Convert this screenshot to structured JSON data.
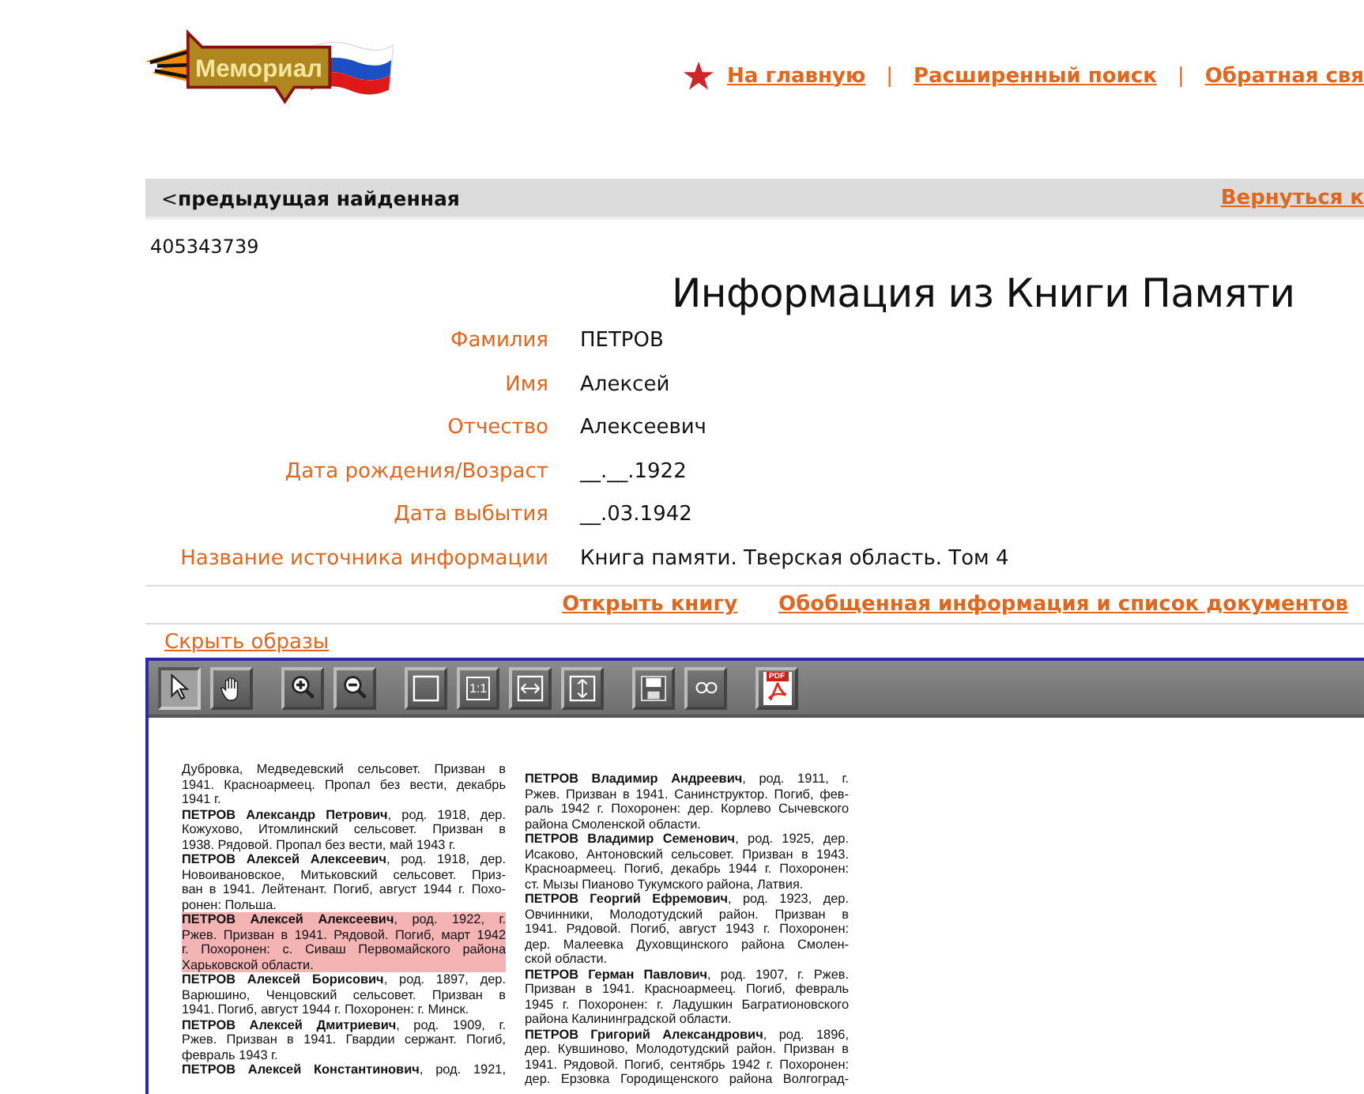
{
  "logo": {
    "text": "Мемориал"
  },
  "nav": {
    "separator": "|",
    "links": [
      {
        "label": "На главную"
      },
      {
        "label": "Расширенный поиск"
      },
      {
        "label": "Обратная свя"
      }
    ]
  },
  "result_bar": {
    "previous": "<**предыдущая найденная**",
    "back": "Вернуться к"
  },
  "record_id": "405343739",
  "title": "Информация из Книги Памяти",
  "fields": [
    {
      "label": "Фамилия",
      "value": "ПЕТРОВ"
    },
    {
      "label": "Имя",
      "value": "Алексей"
    },
    {
      "label": "Отчество",
      "value": "Алексеевич"
    },
    {
      "label": "Дата рождения/Возраст",
      "value": "__.__.1922"
    },
    {
      "label": "Дата выбытия",
      "value": "__.03.1942"
    },
    {
      "label": "Название источника информации",
      "value": "Книга памяти. Тверская область. Том 4"
    }
  ],
  "links": [
    "Открыть книгу",
    "Обобщенная информация и список документов"
  ],
  "hide_images": "Скрыть образы",
  "viewer": {
    "tools": [
      {
        "kind": "select",
        "selected": true
      },
      {
        "kind": "pan",
        "selected": false
      },
      {
        "kind": "zoom-in",
        "selected": false
      },
      {
        "kind": "zoom-out",
        "selected": false
      },
      {
        "kind": "fit-page",
        "selected": false
      },
      {
        "kind": "actual-size",
        "label": "1:1",
        "selected": false
      },
      {
        "kind": "fit-width",
        "selected": false
      },
      {
        "kind": "fit-height",
        "selected": false
      },
      {
        "kind": "save",
        "selected": false
      },
      {
        "kind": "link",
        "selected": false
      },
      {
        "kind": "pdf",
        "label": "PDF",
        "selected": false
      }
    ],
    "columns": [
      [
        {
          "text": "Дубровка, Медведевский сельсовет. Призван в",
          "justified": true,
          "highlighted": false
        },
        {
          "text": "1941. Красноармеец. Пропал без вести, декабрь",
          "justified": true,
          "highlighted": false
        },
        {
          "text": "1941 г.",
          "justified": false,
          "highlighted": false
        },
        {
          "text": "**ПЕТРОВ Александр Петрович**, род. 1918, дер.",
          "justified": true,
          "highlighted": false
        },
        {
          "text": "Кожухово, Итомлинский сельсовет. Призван в",
          "justified": true,
          "highlighted": false
        },
        {
          "text": "1938. Рядовой. Пропал без вести, май 1943 г.",
          "justified": false,
          "highlighted": false
        },
        {
          "text": "**ПЕТРОВ Алексей Алексеевич**, род. 1918, дер.",
          "justified": true,
          "highlighted": false
        },
        {
          "text": "Новоивановское, Митьковский сельсовет. Приз-",
          "justified": true,
          "highlighted": false
        },
        {
          "text": "ван в 1941. Лейтенант. Погиб, август 1944 г. Похо-",
          "justified": true,
          "highlighted": false
        },
        {
          "text": "ронен: Польша.",
          "justified": false,
          "highlighted": false
        },
        {
          "text": "**ПЕТРОВ Алексей Алексеевич**, род. 1922, г.",
          "justified": true,
          "highlighted": true
        },
        {
          "text": "Ржев. Призван в 1941. Рядовой. Погиб, март 1942",
          "justified": true,
          "highlighted": true
        },
        {
          "text": "г. Похоронен: с. Сиваш Первомайского района",
          "justified": true,
          "highlighted": true
        },
        {
          "text": "Харьковской области.",
          "justified": false,
          "highlighted": true
        },
        {
          "text": "**ПЕТРОВ Алексей Борисович**, род. 1897, дер.",
          "justified": true,
          "highlighted": false
        },
        {
          "text": "Варюшино, Ченцовский сельсовет. Призван в",
          "justified": true,
          "highlighted": false
        },
        {
          "text": "1941. Погиб, август 1944 г. Похоронен: г. Минск.",
          "justified": false,
          "highlighted": false
        },
        {
          "text": "**ПЕТРОВ Алексей Дмитриевич**, род. 1909, г.",
          "justified": true,
          "highlighted": false
        },
        {
          "text": "Ржев. Призван в 1941. Гвардии сержант. Погиб,",
          "justified": true,
          "highlighted": false
        },
        {
          "text": "февраль 1943 г.",
          "justified": false,
          "highlighted": false
        },
        {
          "text": "**ПЕТРОВ Алексей Константинович**, род. 1921,",
          "justified": true,
          "highlighted": false
        }
      ],
      [
        {
          "text": "**ПЕТРОВ Владимир Андреевич**, род. 1911, г.",
          "justified": true,
          "highlighted": false
        },
        {
          "text": "Ржев. Призван в 1941. Санинструктор. Погиб, фев-",
          "justified": true,
          "highlighted": false
        },
        {
          "text": "раль 1942 г. Похоронен: дер. Корлево Сычевского",
          "justified": true,
          "highlighted": false
        },
        {
          "text": "района Смоленской области.",
          "justified": false,
          "highlighted": false
        },
        {
          "text": "**ПЕТРОВ Владимир Семенович**, род. 1925, дер.",
          "justified": true,
          "highlighted": false
        },
        {
          "text": "Исаково, Антоновский сельсовет. Призван в 1943.",
          "justified": true,
          "highlighted": false
        },
        {
          "text": "Красноармеец. Погиб, декабрь 1944 г. Похоронен:",
          "justified": true,
          "highlighted": false
        },
        {
          "text": "ст. Мызы Пианово Тукумского района, Латвия.",
          "justified": false,
          "highlighted": false
        },
        {
          "text": "**ПЕТРОВ Георгий Ефремович**, род. 1923, дер.",
          "justified": true,
          "highlighted": false
        },
        {
          "text": "Овчинники, Молодотудский район. Призван в",
          "justified": true,
          "highlighted": false
        },
        {
          "text": "1941. Рядовой. Погиб, август 1943 г. Похоронен:",
          "justified": true,
          "highlighted": false
        },
        {
          "text": "дер. Малеевка Духовщинского района Смолен-",
          "justified": true,
          "highlighted": false
        },
        {
          "text": "ской области.",
          "justified": false,
          "highlighted": false
        },
        {
          "text": "**ПЕТРОВ Герман Павлович**, род. 1907, г. Ржев.",
          "justified": true,
          "highlighted": false
        },
        {
          "text": "Призван в 1941. Красноармеец. Погиб, февраль",
          "justified": true,
          "highlighted": false
        },
        {
          "text": "1945 г. Похоронен: г. Ладушкин Багратионовского",
          "justified": true,
          "highlighted": false
        },
        {
          "text": "района Калининградской области.",
          "justified": false,
          "highlighted": false
        },
        {
          "text": "**ПЕТРОВ Григорий Александрович**, род. 1896,",
          "justified": true,
          "highlighted": false
        },
        {
          "text": "дер. Кувшиново, Молодотудский район. Призван в",
          "justified": true,
          "highlighted": false
        },
        {
          "text": "1941. Рядовой. Погиб, сентябрь 1942 г. Похоронен:",
          "justified": true,
          "highlighted": false
        },
        {
          "text": "дер. Ерзовка Городищенского района Волгоград-",
          "justified": true,
          "highlighted": false
        }
      ]
    ]
  }
}
